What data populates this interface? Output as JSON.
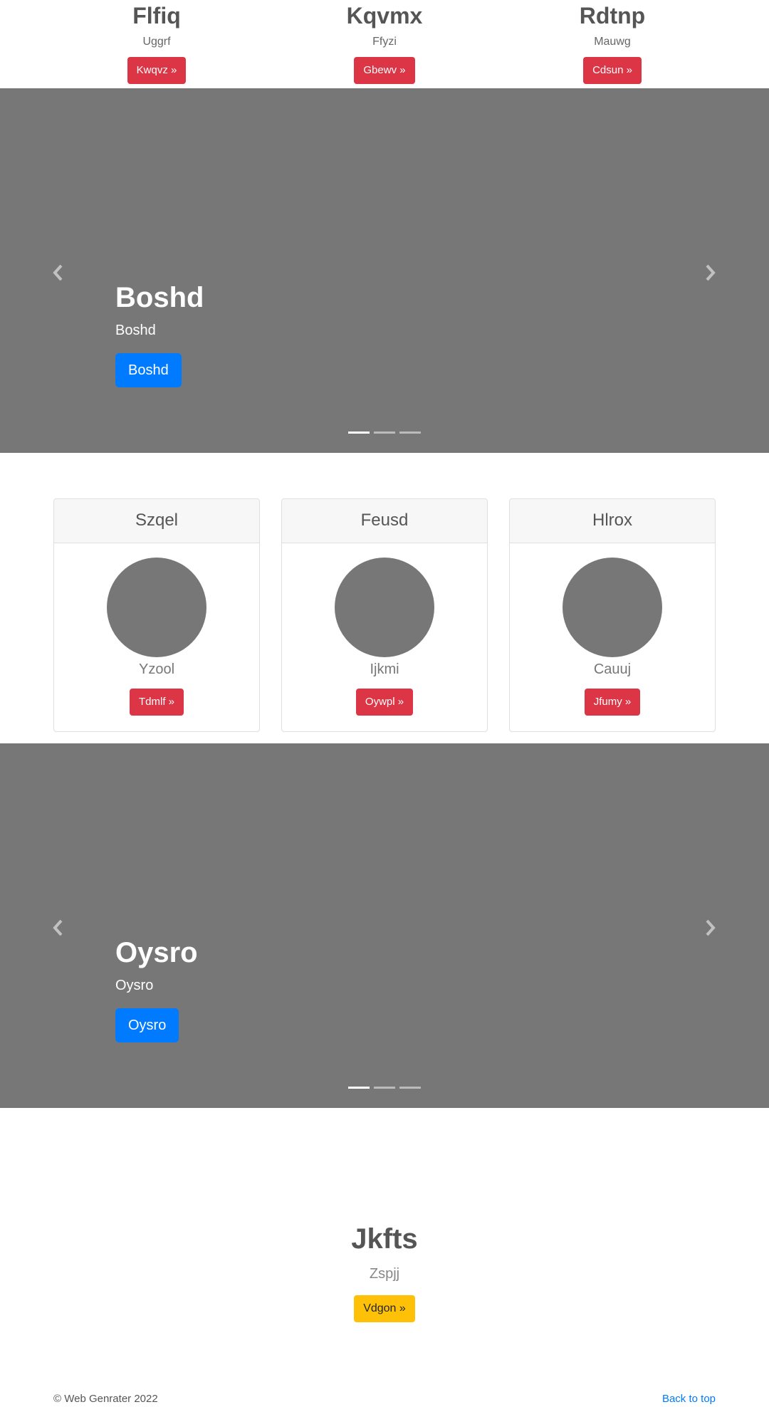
{
  "top_columns": [
    {
      "title": "Flfiq",
      "subtitle": "Uggrf",
      "button": "Kwqvz »"
    },
    {
      "title": "Kqvmx",
      "subtitle": "Ffyzi",
      "button": "Gbewv »"
    },
    {
      "title": "Rdtnp",
      "subtitle": "Mauwg",
      "button": "Cdsun »"
    }
  ],
  "carousel_1": {
    "title": "Boshd",
    "subtitle": "Boshd",
    "button": "Boshd",
    "active_slide": 1,
    "slide_count": 3
  },
  "cards": [
    {
      "header": "Szqel",
      "name": "Yzool",
      "button": "Tdmlf »"
    },
    {
      "header": "Feusd",
      "name": "Ijkmi",
      "button": "Oywpl »"
    },
    {
      "header": "Hlrox",
      "name": "Cauuj",
      "button": "Jfumy »"
    }
  ],
  "carousel_2": {
    "title": "Oysro",
    "subtitle": "Oysro",
    "button": "Oysro",
    "active_slide": 1,
    "slide_count": 3
  },
  "jumbotron": {
    "title": "Jkfts",
    "subtitle": "Zspjj",
    "button": "Vdgon »"
  },
  "footer": {
    "copyright": "© Web Genrater 2022",
    "back_to_top": "Back to top"
  },
  "colors": {
    "danger": "#dc3545",
    "primary": "#007bff",
    "warning": "#ffc107",
    "placeholder": "#777777"
  }
}
